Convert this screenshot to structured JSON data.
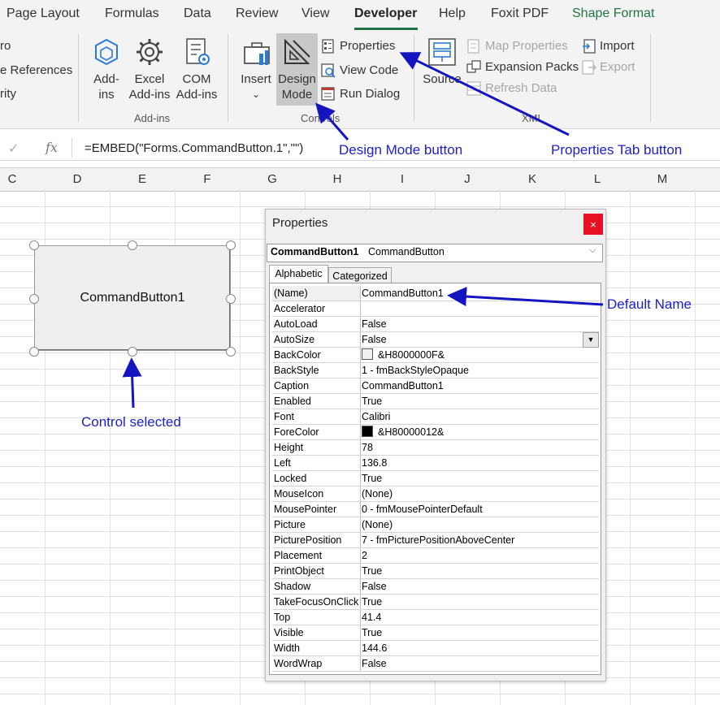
{
  "ribbon": {
    "tabs": [
      "Page Layout",
      "Formulas",
      "Data",
      "Review",
      "View",
      "Developer",
      "Help",
      "Foxit PDF",
      "Shape Format"
    ],
    "active_tab": "Developer",
    "code_group": {
      "macro_partial": "ro",
      "references_partial": "e References",
      "security_partial": "rity"
    },
    "addins_group": {
      "label": "Add-ins",
      "addins_btn": [
        "Add-",
        "ins"
      ],
      "excel_addins_btn": [
        "Excel",
        "Add-ins"
      ],
      "com_addins_btn": [
        "COM",
        "Add-ins"
      ]
    },
    "controls_group": {
      "label": "Controls",
      "insert_btn": "Insert",
      "design_mode_btn": [
        "Design",
        "Mode"
      ],
      "properties": "Properties",
      "view_code": "View Code",
      "run_dialog": "Run Dialog"
    },
    "xml_group": {
      "label": "XML",
      "source_btn": "Source",
      "map_properties": "Map Properties",
      "expansion_packs": "Expansion Packs",
      "refresh_data": "Refresh Data",
      "import": "Import",
      "export": "Export"
    }
  },
  "formula_bar": {
    "fx": "fx",
    "formula": "=EMBED(\"Forms.CommandButton.1\",\"\")"
  },
  "columns": [
    "C",
    "D",
    "E",
    "F",
    "G",
    "H",
    "I",
    "J",
    "K",
    "L",
    "M"
  ],
  "command_button": {
    "caption": "CommandButton1"
  },
  "annotations": {
    "design_mode": "Design Mode button",
    "properties_tab": "Properties Tab button",
    "default_name": "Default Name",
    "control_selected": "Control selected"
  },
  "properties_window": {
    "title": "Properties",
    "close": "×",
    "object_name": "CommandButton1",
    "object_type": "CommandButton",
    "tabs": [
      "Alphabetic",
      "Categorized"
    ],
    "rows": [
      {
        "name": "(Name)",
        "value": "CommandButton1"
      },
      {
        "name": "Accelerator",
        "value": ""
      },
      {
        "name": "AutoLoad",
        "value": "False"
      },
      {
        "name": "AutoSize",
        "value": "False"
      },
      {
        "name": "BackColor",
        "value": "&H8000000F&",
        "swatch": "#f0f0f0"
      },
      {
        "name": "BackStyle",
        "value": "1 - fmBackStyleOpaque"
      },
      {
        "name": "Caption",
        "value": "CommandButton1"
      },
      {
        "name": "Enabled",
        "value": "True"
      },
      {
        "name": "Font",
        "value": "Calibri"
      },
      {
        "name": "ForeColor",
        "value": "&H80000012&",
        "swatch": "#000000"
      },
      {
        "name": "Height",
        "value": "78"
      },
      {
        "name": "Left",
        "value": "136.8"
      },
      {
        "name": "Locked",
        "value": "True"
      },
      {
        "name": "MouseIcon",
        "value": "(None)"
      },
      {
        "name": "MousePointer",
        "value": "0 - fmMousePointerDefault"
      },
      {
        "name": "Picture",
        "value": "(None)"
      },
      {
        "name": "PicturePosition",
        "value": "7 - fmPicturePositionAboveCenter"
      },
      {
        "name": "Placement",
        "value": "2"
      },
      {
        "name": "PrintObject",
        "value": "True"
      },
      {
        "name": "Shadow",
        "value": "False"
      },
      {
        "name": "TakeFocusOnClick",
        "value": "True"
      },
      {
        "name": "Top",
        "value": "41.4"
      },
      {
        "name": "Visible",
        "value": "True"
      },
      {
        "name": "Width",
        "value": "144.6"
      },
      {
        "name": "WordWrap",
        "value": "False"
      }
    ]
  },
  "colors": {
    "accent": "#217346",
    "annotation": "#2020c8",
    "close_red": "#e81123"
  }
}
